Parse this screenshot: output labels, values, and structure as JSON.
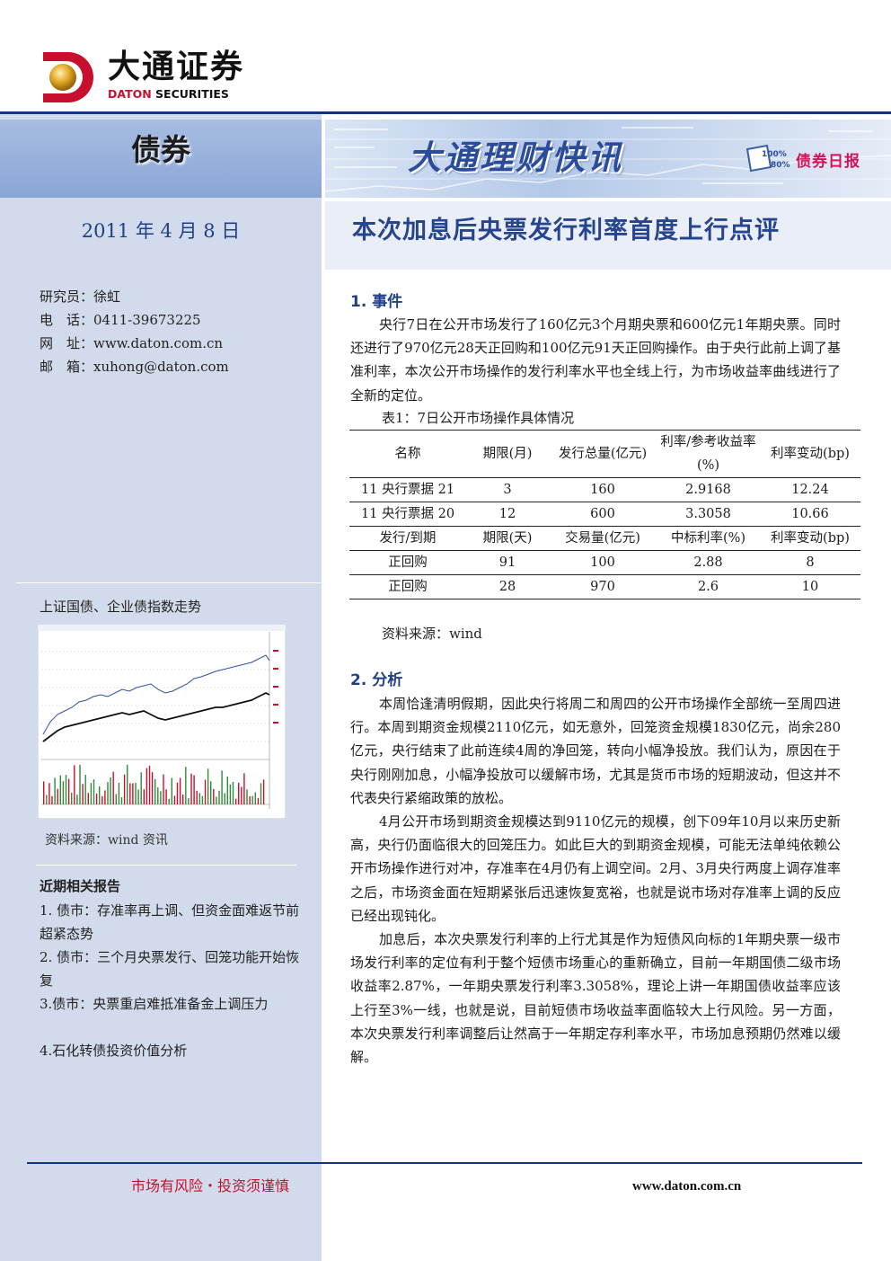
{
  "brand": {
    "name_cn": "大通证券",
    "name_en_red": "DATON",
    "name_en_rest": " SECURITIES"
  },
  "header": {
    "category": "债券",
    "banner_title": "大通理财快讯",
    "badge_pct_1": "100%",
    "badge_pct_2": "80%",
    "daily_label": "债券日报"
  },
  "date": "2011 年 4 月 8 日",
  "title": "本次加息后央票发行利率首度上行点评",
  "contact": [
    {
      "label": "研究员：",
      "value": "徐虹"
    },
    {
      "label": "电　话：",
      "value": "0411-39673225"
    },
    {
      "label": "网　址：",
      "value": "www.daton.com.cn"
    },
    {
      "label": "邮　箱：",
      "value": "xuhong@daton.com"
    }
  ],
  "sidebar_chart": {
    "title": "上证国债、企业债指数走势",
    "source": "资料来源：wind 资讯"
  },
  "related_reports": {
    "heading": "近期相关报告",
    "items": [
      "1. 债市：存准率再上调、但资金面难返节前超紧态势",
      "2. 债市：三个月央票发行、回笼功能开始恢复",
      "3.债市：央票重启难抵准备金上调压力",
      "4.石化转债投资价值分析"
    ]
  },
  "section1": {
    "heading": "1.  事件",
    "para": "央行7日在公开市场发行了160亿元3个月期央票和600亿元1年期央票。同时还进行了970亿元28天正回购和100亿元91天正回购操作。由于央行此前上调了基准利率，本次公开市场操作的发行利率水平也全线上行，为市场收益率曲线进行了全新的定位。"
  },
  "table": {
    "caption": "表1：7日公开市场操作具体情况",
    "header1": [
      "名称",
      "期限(月)",
      "发行总量(亿元)",
      "利率/参考收益率(%)",
      "利率变动(bp)"
    ],
    "rows1": [
      [
        "11 央行票据 21",
        "3",
        "160",
        "2.9168",
        "12.24"
      ],
      [
        "11 央行票据 20",
        "12",
        "600",
        "3.3058",
        "10.66"
      ]
    ],
    "header2": [
      "发行/到期",
      "期限(天)",
      "交易量(亿元)",
      "中标利率(%)",
      "利率变动(bp)"
    ],
    "rows2": [
      [
        "正回购",
        "91",
        "100",
        "2.88",
        "8"
      ],
      [
        "正回购",
        "28",
        "970",
        "2.6",
        "10"
      ]
    ],
    "source": "资料来源：wind"
  },
  "section2": {
    "heading": "2.  分析",
    "paras": [
      "本周恰逢清明假期，因此央行将周二和周四的公开市场操作全部统一至周四进行。本周到期资金规模2110亿元，如无意外，回笼资金规模1830亿元，尚余280亿元，央行结束了此前连续4周的净回笼，转向小幅净投放。我们认为，原因在于央行刚刚加息，小幅净投放可以缓解市场，尤其是货币市场的短期波动，但这并不代表央行紧缩政策的放松。",
      "4月公开市场到期资金规模达到9110亿元的规模，创下09年10月以来历史新高，央行仍面临很大的回笼压力。如此巨大的到期资金规模，可能无法单纯依赖公开市场操作进行对冲，存准率在4月仍有上调空间。2月、3月央行两度上调存准率之后，市场资金面在短期紧张后迅速恢复宽裕，也就是说市场对存准率上调的反应已经出现钝化。",
      "加息后，本次央票发行利率的上行尤其是作为短债风向标的1年期央票一级市场发行利率的定位有利于整个短债市场重心的重新确立，目前一年期国债二级市场收益率2.87%，一年期央票发行利率3.3058%，理论上讲一年期国债收益率应该上行至3%一线，也就是说，目前短债市场收益率面临较大上行风险。另一方面，本次央票发行利率调整后让然高于一年期定存利率水平，市场加息预期仍然难以缓解。"
    ]
  },
  "footer": {
    "risk": "市场有风险・投资须谨慎",
    "website": "www.daton.com.cn"
  }
}
